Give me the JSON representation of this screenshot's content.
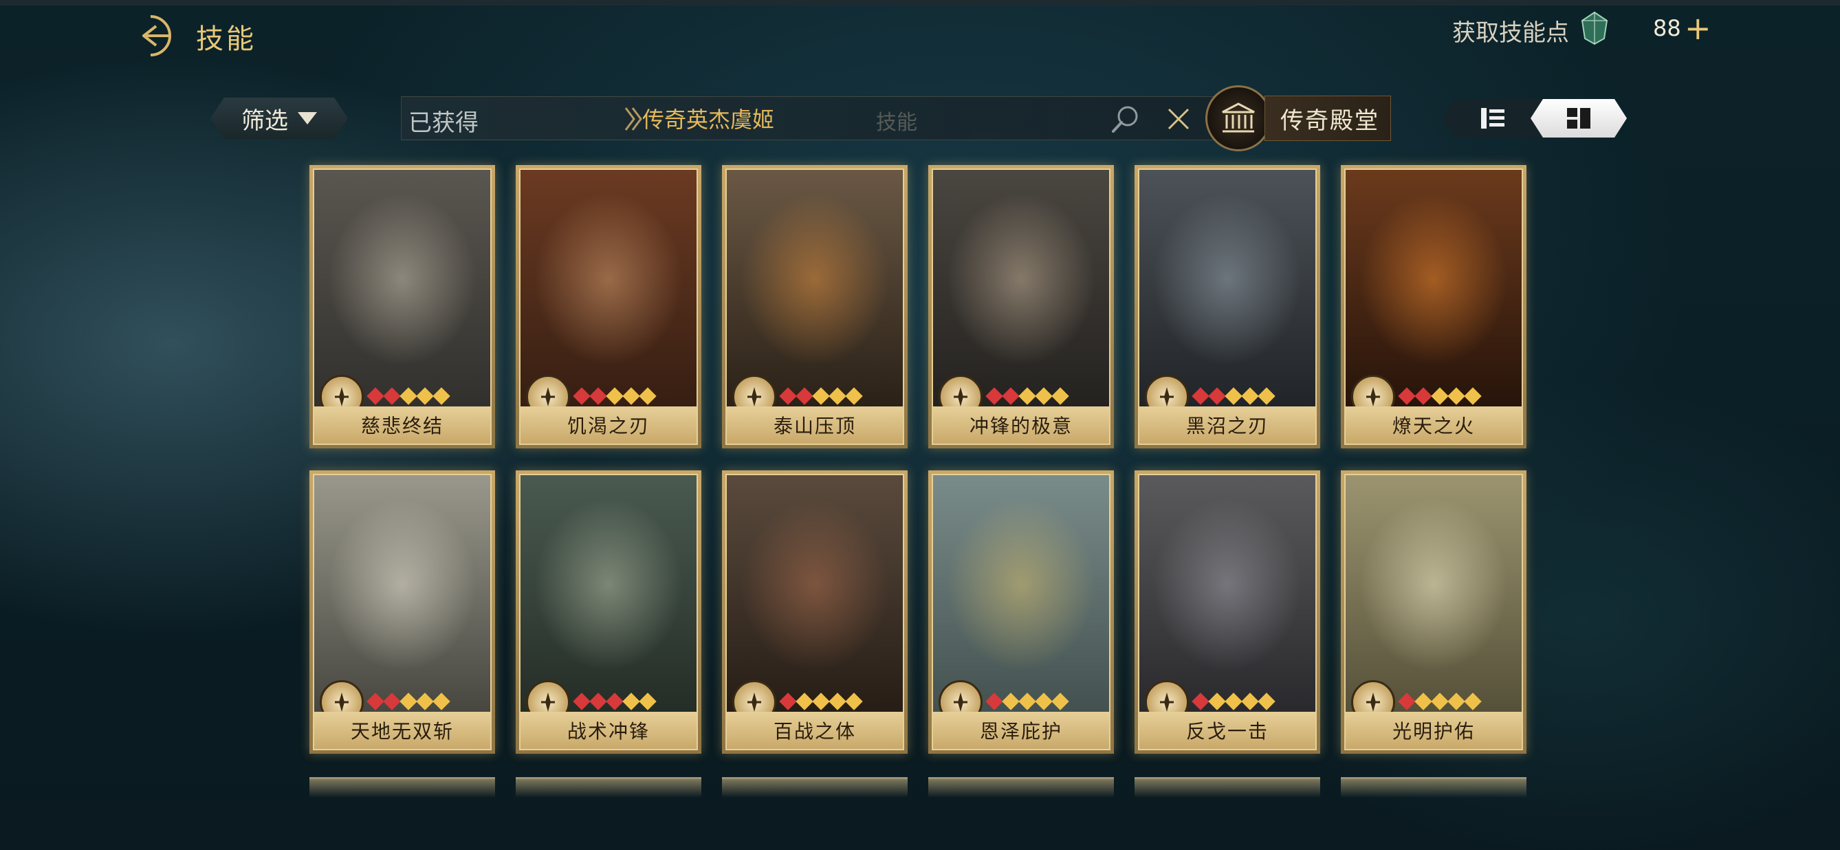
{
  "header": {
    "title": "技能",
    "points_label": "获取技能点",
    "points_value": "88",
    "plus": "+"
  },
  "toolbar": {
    "filter_label": "筛选",
    "tab_owned": "已获得",
    "search_value": "传奇英杰虞姬",
    "search_placeholder": "技能",
    "hall_label": "传奇殿堂"
  },
  "cards": [
    {
      "name": "慈悲终结",
      "red_stars": 2,
      "gold_stars": 3
    },
    {
      "name": "饥渴之刃",
      "red_stars": 2,
      "gold_stars": 3
    },
    {
      "name": "泰山压顶",
      "red_stars": 2,
      "gold_stars": 3
    },
    {
      "name": "冲锋的极意",
      "red_stars": 2,
      "gold_stars": 3
    },
    {
      "name": "黑沼之刃",
      "red_stars": 2,
      "gold_stars": 3
    },
    {
      "name": "燎天之火",
      "red_stars": 2,
      "gold_stars": 3
    },
    {
      "name": "天地无双斩",
      "red_stars": 2,
      "gold_stars": 3
    },
    {
      "name": "战术冲锋",
      "red_stars": 3,
      "gold_stars": 2
    },
    {
      "name": "百战之体",
      "red_stars": 1,
      "gold_stars": 4
    },
    {
      "name": "恩泽庇护",
      "red_stars": 1,
      "gold_stars": 4
    },
    {
      "name": "反戈一击",
      "red_stars": 1,
      "gold_stars": 4
    },
    {
      "name": "光明护佑",
      "red_stars": 1,
      "gold_stars": 4
    }
  ],
  "colors": {
    "accent_gold": "#e9c878",
    "card_frame": "#c9a869",
    "star_red": "#d8393a",
    "star_gold": "#f0c14a"
  }
}
